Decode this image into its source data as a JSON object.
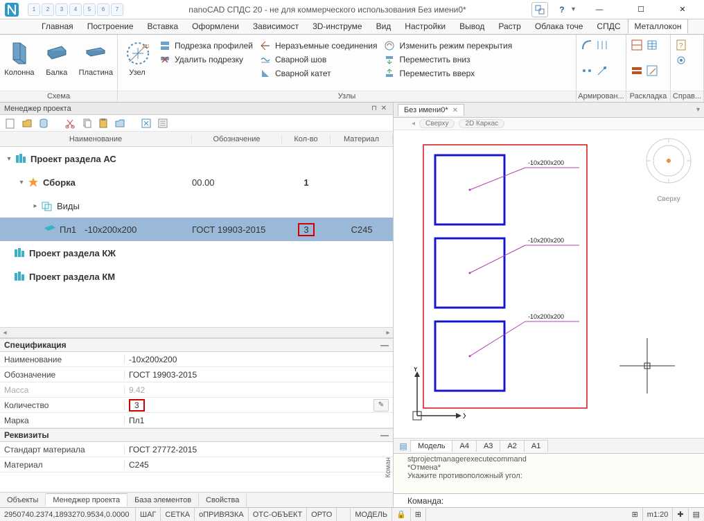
{
  "app": {
    "title": "nanoCAD СПДС 20 - не для коммерческого использования Без имени0*",
    "qat": [
      "1",
      "2",
      "3",
      "4",
      "5",
      "6",
      "7"
    ]
  },
  "tabs": [
    "Главная",
    "Построение",
    "Вставка",
    "Оформлени",
    "Зависимост",
    "3D-инструме",
    "Вид",
    "Настройки",
    "Вывод",
    "Растр",
    "Облака точе",
    "СПДС",
    "Металлокон"
  ],
  "activeTab": 12,
  "ribbon": {
    "schema": {
      "label": "Схема",
      "items": [
        {
          "label": "Колонна"
        },
        {
          "label": "Балка"
        },
        {
          "label": "Пластина"
        }
      ]
    },
    "nodes": {
      "label": "Узлы",
      "uzel": "Узел",
      "col1": [
        {
          "label": "Подрезка профилей"
        },
        {
          "label": "Удалить подрезку"
        }
      ],
      "col2": [
        {
          "label": "Неразъемные соединения"
        },
        {
          "label": "Сварной шов"
        },
        {
          "label": "Сварной катет"
        }
      ],
      "col3": [
        {
          "label": "Изменить режим перекрытия"
        },
        {
          "label": "Переместить вниз"
        },
        {
          "label": "Переместить вверх"
        }
      ]
    },
    "arm": {
      "label": "Армирован..."
    },
    "layout": {
      "label": "Раскладка"
    },
    "help": {
      "label": "Справ..."
    }
  },
  "pm": {
    "title": "Менеджер проекта",
    "headers": [
      "Наименование",
      "Обозначение",
      "Кол-во",
      "Материал"
    ],
    "tree": {
      "root1": {
        "name": "Проект раздела АС"
      },
      "assembly": {
        "name": "Сборка",
        "code": "00.00",
        "qty": "1"
      },
      "views": {
        "name": "Виды"
      },
      "pl1": {
        "name": "Пл1",
        "size": "-10x200x200",
        "std": "ГОСТ 19903-2015",
        "qty": "3",
        "mat": "С245"
      },
      "root2": {
        "name": "Проект раздела КЖ"
      },
      "root3": {
        "name": "Проект раздела КМ"
      }
    }
  },
  "spec": {
    "header": "Спецификация",
    "rows": [
      {
        "k": "Наименование",
        "v": "-10x200x200"
      },
      {
        "k": "Обозначение",
        "v": "ГОСТ 19903-2015"
      },
      {
        "k": "Масса",
        "v": "9.42",
        "dis": true
      },
      {
        "k": "Количество",
        "v": "3",
        "edit": true,
        "red": true
      },
      {
        "k": "Марка",
        "v": "Пл1"
      }
    ]
  },
  "req": {
    "header": "Реквизиты",
    "rows": [
      {
        "k": "Стандарт материала",
        "v": "ГОСТ 27772-2015"
      },
      {
        "k": "Материал",
        "v": "С245"
      }
    ]
  },
  "bottomTabs": [
    "Объекты",
    "Менеджер проекта",
    "База элементов",
    "Свойства"
  ],
  "activeBTab": 1,
  "docTab": "Без имени0*",
  "viewTabs": [
    "Сверху",
    "2D Каркас"
  ],
  "modelTabs": [
    "Модель",
    "A4",
    "A3",
    "A2",
    "A1"
  ],
  "viewcube": "Сверху",
  "drawing": {
    "labels": [
      "-10x200x200",
      "-10x200x200",
      "-10x200x200"
    ]
  },
  "cmdlog": [
    "stprojectmanagerexecutecommand",
    "*Отмена*",
    "",
    "Укажите противоположный угол:"
  ],
  "cmdprompt": "Команда:",
  "status": {
    "coords": "2950740.2374,1893270.9534,0.0000",
    "toggles": [
      "ШАГ",
      "СЕТКА",
      "оПРИВЯЗКА",
      "ОТС-ОБЪЕКТ",
      "ОРТО"
    ],
    "model": "МОДЕЛЬ",
    "scale": "m1:20"
  }
}
